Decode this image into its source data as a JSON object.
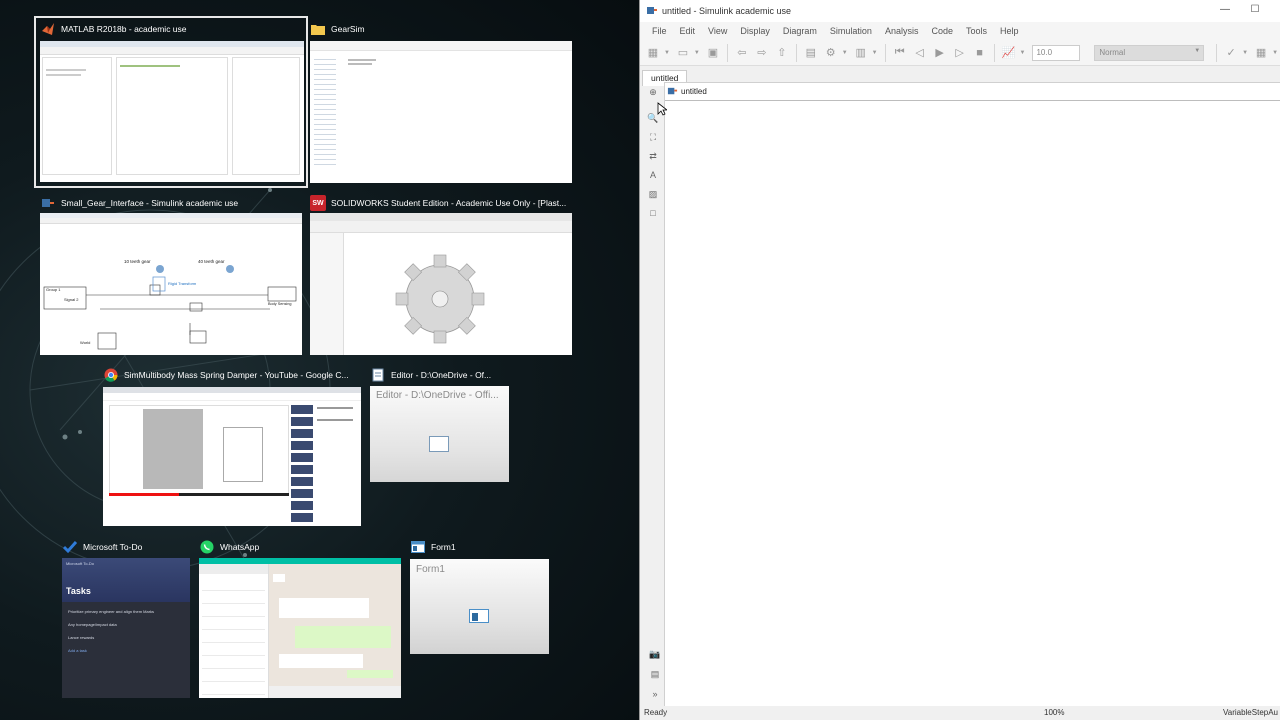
{
  "taskview": {
    "windows": [
      {
        "title": "MATLAB R2018b - academic use",
        "icon": "matlab-icon",
        "selected": true
      },
      {
        "title": "GearSim",
        "icon": "folder-icon"
      },
      {
        "title": "Small_Gear_Interface - Simulink academic use",
        "icon": "simulink-icon",
        "labels": {
          "gear_a": "10 teeth gear",
          "gear_b": "40 teeth gear",
          "rigid": "Rigid Transform",
          "body": "Body Sensing",
          "group": "Group 1",
          "signal": "Signal 2",
          "world": "World"
        }
      },
      {
        "title": "SOLIDWORKS Student Edition - Academic Use Only - [Plast...",
        "icon": "solidworks-icon"
      },
      {
        "title": "SimMultibody Mass Spring Damper - YouTube - Google C...",
        "icon": "chrome-icon"
      },
      {
        "title": "Editor - D:\\OneDrive - Of...",
        "icon": "notepad-icon",
        "preview_text": "Editor - D:\\OneDrive - Offi..."
      },
      {
        "title": "Microsoft To-Do",
        "icon": "todo-check-icon",
        "app_name": "Microsoft To-Do",
        "heading": "Tasks",
        "tasks": [
          "Prioritize primary engineer and align them Marks",
          "Any homepage/impact data",
          "Lance rewards"
        ],
        "add_task": "Add a task"
      },
      {
        "title": "WhatsApp",
        "icon": "whatsapp-icon"
      },
      {
        "title": "Form1",
        "icon": "form-icon",
        "preview_text": "Form1"
      }
    ]
  },
  "simulink": {
    "title": "untitled - Simulink academic use",
    "menu": [
      "File",
      "Edit",
      "View",
      "Display",
      "Diagram",
      "Simulation",
      "Analysis",
      "Code",
      "Tools",
      "Help"
    ],
    "stop_time": "10.0",
    "sim_mode": "Normal",
    "tab": "untitled",
    "breadcrumb": "untitled",
    "status": {
      "left": "Ready",
      "zoom": "100%",
      "solver": "VariableStepAu"
    }
  }
}
